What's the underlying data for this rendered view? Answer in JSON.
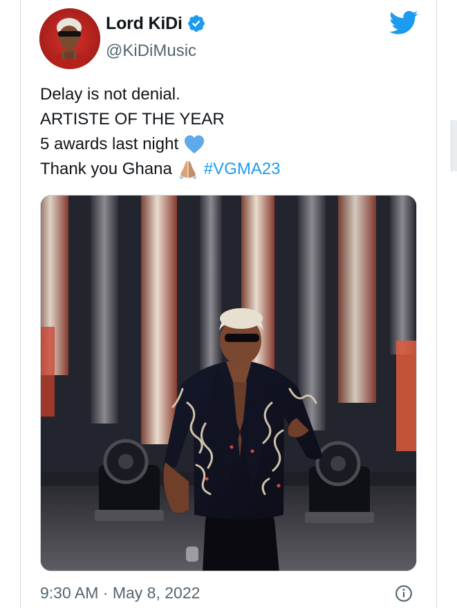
{
  "tweet": {
    "author": {
      "name": "Lord KiDi",
      "handle": "@KiDiMusic",
      "verified": true
    },
    "text_lines": [
      "Delay is not denial.",
      "ARTISTE OF THE YEAR",
      "5 awards last night",
      "Thank you Ghana"
    ],
    "line3_emoji": "blue-heart-icon",
    "line4_emoji": "folded-hands-icon",
    "hashtag": "#VGMA23",
    "timestamp": "9:30 AM · May 8, 2022"
  },
  "icons": {
    "brand": "twitter-bird-icon",
    "verified": "verified-badge-icon",
    "info": "info-icon"
  },
  "colors": {
    "text": "#0f1419",
    "secondary": "#536471",
    "accent": "#1d9bf0",
    "border": "#cfd9de"
  }
}
